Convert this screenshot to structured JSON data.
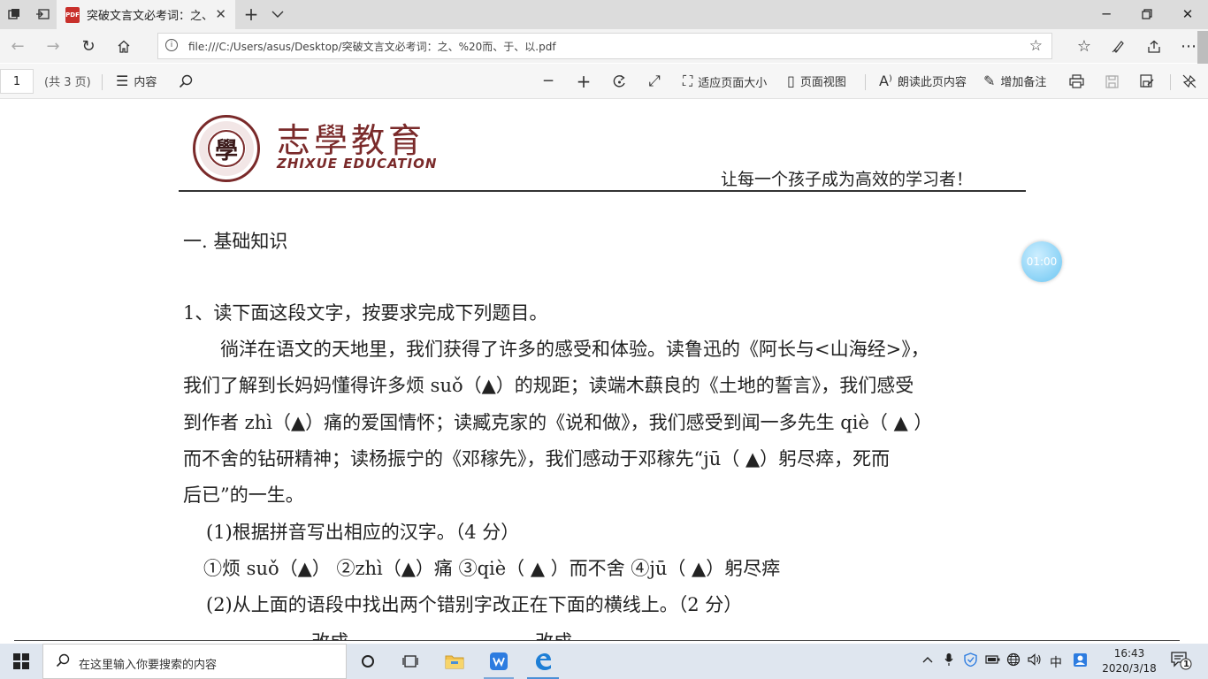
{
  "browser": {
    "tab_title": "突破文言文必考词：之、",
    "tab_badge": "PDF",
    "address_url": "file:///C:/Users/asus/Desktop/突破文言文必考词：之、%20而、于、以.pdf"
  },
  "pdf_toolbar": {
    "page_number": "1",
    "page_count": "(共 3 页)",
    "contents_label": "内容",
    "fit_page_label": "适应页面大小",
    "page_view_label": "页面视图",
    "read_aloud_label": "朗读此页内容",
    "add_notes_label": "增加备注"
  },
  "document": {
    "logo_seal_char": "學",
    "logo_cn": "志學教育",
    "logo_en": "ZHIXUE EDUCATION",
    "slogan": "让每一个孩子成为高效的学习者！",
    "section_title": "一. 基础知识",
    "question_title": "1、读下面这段文字，按要求完成下列题目。",
    "paragraph_lines": [
      "　　徜洋在语文的天地里，我们获得了许多的感受和体验。读鲁迅的《阿长与<山海经>》，",
      "我们了解到长妈妈懂得许多烦 suǒ（▲）的规距；读端木蕻良的《土地的誓言》，我们感受",
      "到作者 zhì（▲）痛的爱国情怀；读臧克家的《说和做》，我们感受到闻一多先生 qiè（ ▲ ）",
      "而不舍的钻研精神；读杨振宁的《邓稼先》，我们感动于邓稼先“jū（ ▲）躬尽瘁，死而",
      "后已”的一生。"
    ],
    "sub1_title": "(1)根据拼音写出相应的汉字。（4 分）",
    "sub1_items": "①烦 suǒ（▲） ②zhì（▲）痛 ③qiè（ ▲ ）而不舍 ④jū（ ▲）躬尽瘁",
    "sub2_title": "(2)从上面的语段中找出两个错别字改正在下面的横线上。（2 分）",
    "correct_label_1": "改成",
    "correct_label_2": "改成",
    "timer": "01:00"
  },
  "taskbar": {
    "search_placeholder": "在这里输入你要搜索的内容",
    "ime_label": "中",
    "time": "16:43",
    "date": "2020/3/18",
    "notification_count": "1"
  }
}
